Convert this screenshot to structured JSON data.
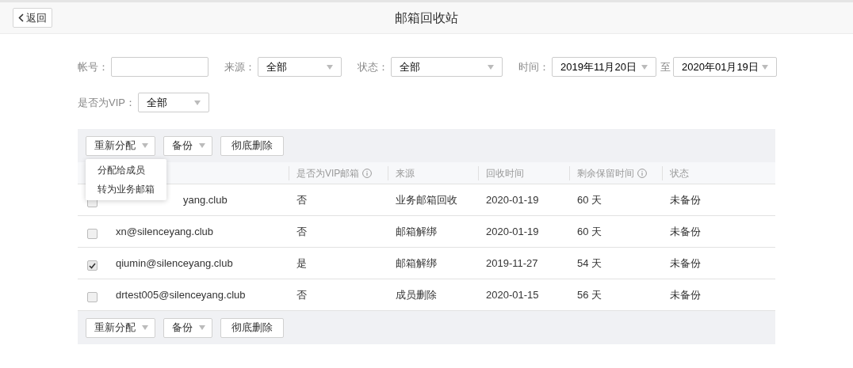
{
  "header": {
    "back": "返回",
    "title": "邮箱回收站"
  },
  "filter_rows": [
    [
      {
        "kind": "input",
        "label": "帐号："
      },
      {
        "kind": "select",
        "label": "来源：",
        "value": "全部"
      },
      {
        "kind": "select",
        "label": "状态：",
        "value": "全部"
      },
      {
        "kind": "select",
        "label": "时间：",
        "value": "2019年11月20日"
      },
      {
        "kind": "select",
        "label": "至",
        "value": "2020年01月19日"
      }
    ],
    [
      {
        "kind": "select",
        "label": "是否为VIP：",
        "value": "全部"
      }
    ]
  ],
  "toolbar": [
    {
      "label": "重新分配",
      "kind": "dropdown"
    },
    {
      "label": "备份",
      "kind": "dropdown"
    },
    {
      "label": "彻底删除",
      "kind": "button"
    }
  ],
  "menu": [
    "分配给成员",
    "转为业务邮箱"
  ],
  "table": {
    "columns": [
      {
        "label": "是否为VIP邮箱",
        "info": true
      },
      {
        "label": "来源",
        "info": false
      },
      {
        "label": "回收时间",
        "info": false
      },
      {
        "label": "剩余保留时间",
        "info": true
      },
      {
        "label": "状态",
        "info": false
      }
    ],
    "rows": [
      {
        "checked": false,
        "email": "yang.club",
        "vip": "否",
        "source": "业务邮箱回收",
        "time": "2020-01-19",
        "remaining": "60 天",
        "status": "未备份"
      },
      {
        "checked": false,
        "email": "xn@silenceyang.club",
        "vip": "否",
        "source": "邮箱解绑",
        "time": "2020-01-19",
        "remaining": "60 天",
        "status": "未备份"
      },
      {
        "checked": true,
        "email": "qiumin@silenceyang.club",
        "vip": "是",
        "source": "邮箱解绑",
        "time": "2019-11-27",
        "remaining": "54 天",
        "status": "未备份"
      },
      {
        "checked": false,
        "email": "drtest005@silenceyang.club",
        "vip": "否",
        "source": "成员删除",
        "time": "2020-01-15",
        "remaining": "56 天",
        "status": "未备份"
      }
    ]
  },
  "footer_toolbar": [
    {
      "label": "重新分配",
      "kind": "dropdown"
    },
    {
      "label": "备份",
      "kind": "dropdown"
    },
    {
      "label": "彻底删除",
      "kind": "button"
    }
  ]
}
